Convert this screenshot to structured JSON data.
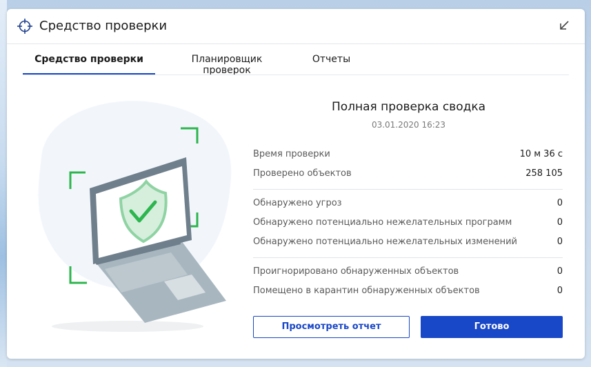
{
  "window": {
    "title": "Средство проверки"
  },
  "tabs": [
    {
      "label": "Средство проверки",
      "active": true
    },
    {
      "label": "Планировщик проверок",
      "active": false
    },
    {
      "label": "Отчеты",
      "active": false
    }
  ],
  "summary": {
    "title": "Полная проверка сводка",
    "date": "03.01.2020 16:23"
  },
  "stats": {
    "group1": [
      {
        "label": "Время проверки",
        "value": "10 м 36 с"
      },
      {
        "label": "Проверено объектов",
        "value": "258 105"
      }
    ],
    "group2": [
      {
        "label": "Обнаружено угроз",
        "value": "0"
      },
      {
        "label": "Обнаружено потенциально нежелательных программ",
        "value": "0"
      },
      {
        "label": "Обнаружено потенциально нежелательных изменений",
        "value": "0"
      }
    ],
    "group3": [
      {
        "label": "Проигнорировано обнаруженных объектов",
        "value": "0"
      },
      {
        "label": "Помещено в карантин обнаруженных объектов",
        "value": "0"
      }
    ]
  },
  "buttons": {
    "view_report": "Просмотреть отчет",
    "done": "Готово"
  },
  "colors": {
    "accent": "#1847c7",
    "shield": "#4cba6a",
    "bracket": "#2db54e",
    "laptop": "#6f7f8c"
  },
  "icons": {
    "title": "crosshair-icon",
    "collapse": "arrow-down-left-icon"
  }
}
